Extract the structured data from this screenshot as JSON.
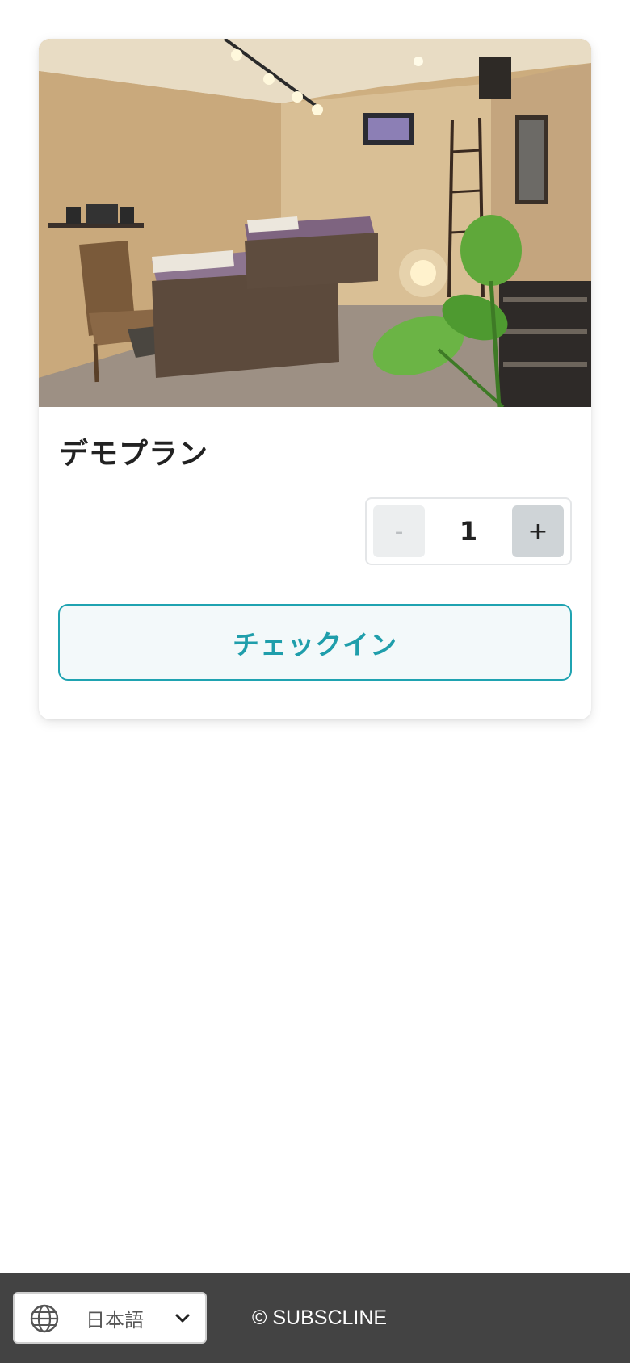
{
  "plan": {
    "title": "デモプラン",
    "image_alt": "施術ルーム"
  },
  "quantity": {
    "minus_label": "-",
    "value": "1",
    "plus_label": "+"
  },
  "checkin": {
    "label": "チェックイン"
  },
  "footer": {
    "language_label": "日本語",
    "copyright": "© SUBSCLINE"
  },
  "colors": {
    "accent": "#1fa3b1",
    "footer_bg": "#434343"
  },
  "icons": {
    "globe": "globe-icon",
    "chevron": "chevron-down-icon"
  }
}
